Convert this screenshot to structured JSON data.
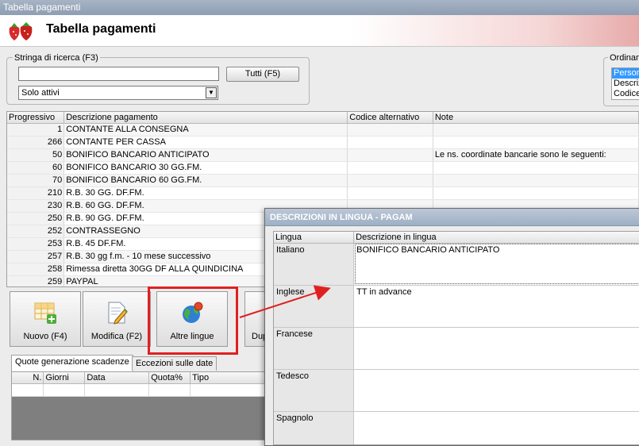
{
  "window": {
    "title": "Tabella pagamenti"
  },
  "header": {
    "title": "Tabella pagamenti",
    "logo_icon": "strawberry-icon"
  },
  "search": {
    "legend": "Stringa di ricerca (F3)",
    "input_value": "",
    "all_button": "Tutti (F5)",
    "filter_value": "Solo attivi"
  },
  "order": {
    "legend": "Ordinam",
    "items": [
      "Person",
      "Descriz",
      "Codice"
    ]
  },
  "grid": {
    "columns": [
      "Progressivo",
      "Descrizione pagamento",
      "Codice alternativo",
      "Note"
    ],
    "rows": [
      {
        "prog": "1",
        "desc": "CONTANTE ALLA CONSEGNA",
        "code": "",
        "note": ""
      },
      {
        "prog": "266",
        "desc": "CONTANTE PER CASSA",
        "code": "",
        "note": ""
      },
      {
        "prog": "50",
        "desc": "BONIFICO BANCARIO ANTICIPATO",
        "code": "",
        "note": "Le ns. coordinate bancarie sono le seguenti:"
      },
      {
        "prog": "60",
        "desc": "BONIFICO BANCARIO 30 GG.FM.",
        "code": "",
        "note": ""
      },
      {
        "prog": "70",
        "desc": "BONIFICO BANCARIO 60 GG.FM.",
        "code": "",
        "note": ""
      },
      {
        "prog": "210",
        "desc": "R.B. 30 GG. DF.FM.",
        "code": "",
        "note": ""
      },
      {
        "prog": "230",
        "desc": "R.B. 60 GG. DF.FM.",
        "code": "",
        "note": ""
      },
      {
        "prog": "250",
        "desc": "R.B. 90 GG. DF.FM.",
        "code": "",
        "note": ""
      },
      {
        "prog": "252",
        "desc": "CONTRASSEGNO",
        "code": "",
        "note": ""
      },
      {
        "prog": "253",
        "desc": "R.B. 45 DF.FM.",
        "code": "",
        "note": ""
      },
      {
        "prog": "257",
        "desc": "R.B. 30 gg f.m. - 10 mese successivo",
        "code": "",
        "note": ""
      },
      {
        "prog": "258",
        "desc": "Rimessa diretta 30GG DF ALLA QUINDICINA",
        "code": "",
        "note": ""
      },
      {
        "prog": "259",
        "desc": "PAYPAL",
        "code": "",
        "note": ""
      }
    ]
  },
  "toolbar": {
    "new_label": "Nuovo (F4)",
    "edit_label": "Modifica (F2)",
    "languages_label": "Altre lingue",
    "duplicate_label": "Dup"
  },
  "tabs": [
    "Quote generazione scadenze",
    "Eccezioni sulle date"
  ],
  "subgrid": {
    "columns": [
      "N.",
      "Giorni",
      "Data",
      "Quota%",
      "Tipo"
    ]
  },
  "dialog": {
    "title": "DESCRIZIONI IN LINGUA - PAGAM",
    "columns": [
      "Lingua",
      "Descrizione in lingua"
    ],
    "rows": [
      {
        "lang": "Italiano",
        "desc": "BONIFICO BANCARIO ANTICIPATO"
      },
      {
        "lang": "Inglese",
        "desc": "TT in advance"
      },
      {
        "lang": "Francese",
        "desc": ""
      },
      {
        "lang": "Tedesco",
        "desc": ""
      },
      {
        "lang": "Spagnolo",
        "desc": ""
      }
    ]
  },
  "colors": {
    "highlight": "#e02020",
    "selection": "#3399ff"
  }
}
